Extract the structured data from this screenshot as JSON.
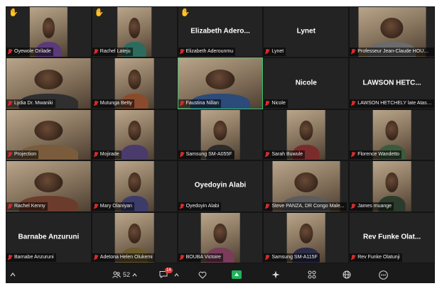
{
  "participants": [
    {
      "name": "Oyewole Orilade",
      "hand": true,
      "video": true
    },
    {
      "name": "Rachel Lateju",
      "hand": true,
      "video": true
    },
    {
      "name": "Elizabeth Aderounmu",
      "display_name": "Elizabeth Adero...",
      "hand": true,
      "video": false
    },
    {
      "name": "Lynet",
      "display_name": "Lynet",
      "video": false
    },
    {
      "name": "Professeur Jean-Claude HOUNM...",
      "video": true
    },
    {
      "name": "Lydia Dr. Mwaniki",
      "video": true
    },
    {
      "name": "Mutunga Betty",
      "video": true
    },
    {
      "name": "Faustina Nillan",
      "video": true,
      "speaking": true
    },
    {
      "name": "Nicole",
      "display_name": "Nicole",
      "video": false
    },
    {
      "name": "LAWSON HETCHELY late Atasse",
      "display_name": "LAWSON HETC...",
      "video": false
    },
    {
      "name": "Projection",
      "video": true
    },
    {
      "name": "Mojirade",
      "video": true
    },
    {
      "name": "Samsung SM-A055F",
      "video": true
    },
    {
      "name": "Sarah Buwule",
      "video": true
    },
    {
      "name": "Florence Wandetto",
      "video": true
    },
    {
      "name": "Rachel Kenny",
      "video": true
    },
    {
      "name": "Mary Olaniyan",
      "video": true
    },
    {
      "name": "Oyedoyin Alabi",
      "display_name": "Oyedoyin Alabi",
      "video": false
    },
    {
      "name": "Steve PANZA, DR Congo Male...",
      "video": true
    },
    {
      "name": "James muange",
      "video": true
    },
    {
      "name": "Barnabe Anzuruni",
      "display_name": "Barnabe Anzuruni",
      "video": false
    },
    {
      "name": "Adetona Helen Olukemi",
      "video": true
    },
    {
      "name": "BOUBA Victoire",
      "video": true
    },
    {
      "name": "Samsung SM-A115F",
      "video": true
    },
    {
      "name": "Rev  Funke Olatunji",
      "display_name": "Rev  Funke Olat...",
      "video": false
    }
  ],
  "toolbar": {
    "participants_count": "52",
    "chat_badge": "14"
  },
  "icons": {
    "hand": "raised-hand-icon",
    "mic": "mic-muted-icon"
  },
  "colors": {
    "speaking_border": "#2ecc71",
    "muted_mic": "#d62b2b",
    "hand": "#f5c518",
    "share": "#1fb35a"
  }
}
